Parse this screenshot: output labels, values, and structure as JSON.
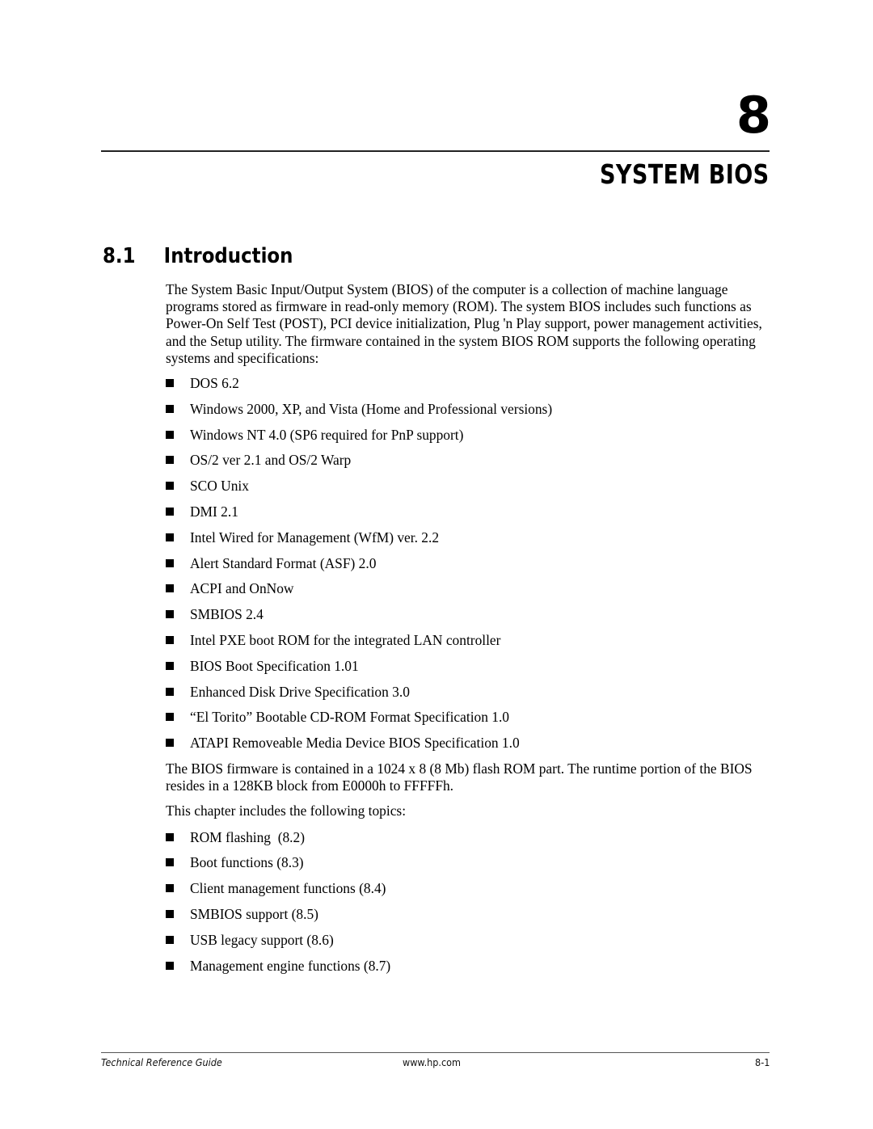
{
  "chapter": {
    "number": "8",
    "title": "SYSTEM BIOS"
  },
  "section": {
    "number": "8.1",
    "title": "Introduction"
  },
  "intro_paragraph": "The System Basic Input/Output System (BIOS) of the computer is a collection of machine language programs stored as firmware in read-only memory (ROM). The system BIOS includes such functions as Power-On Self Test (POST), PCI device initialization, Plug 'n Play support, power management activities, and the Setup utility. The firmware contained in the system BIOS ROM supports the following operating systems and specifications:",
  "supported_list": [
    "DOS 6.2",
    "Windows 2000, XP, and Vista (Home and Professional versions)",
    "Windows NT 4.0 (SP6 required for PnP support)",
    "OS/2 ver 2.1 and OS/2 Warp",
    "SCO Unix",
    "DMI 2.1",
    "Intel Wired for Management (WfM) ver. 2.2",
    "Alert Standard Format (ASF) 2.0",
    "ACPI and OnNow",
    "SMBIOS 2.4",
    "Intel PXE boot ROM for the integrated LAN controller",
    "BIOS Boot Specification 1.01",
    "Enhanced Disk Drive Specification 3.0",
    "“El Torito” Bootable CD-ROM Format Specification 1.0",
    "ATAPI Removeable Media Device BIOS Specification 1.0"
  ],
  "firmware_paragraph": "The BIOS firmware is contained in a 1024 x 8 (8 Mb) flash ROM part. The runtime portion of the BIOS resides in a 128KB block from E0000h to FFFFFh.",
  "topics_intro": "This chapter includes the following topics:",
  "topics_list": [
    "ROM flashing  (8.2)",
    "Boot functions (8.3)",
    "Client management functions (8.4)",
    "SMBIOS support (8.5)",
    "USB legacy support (8.6)",
    "Management engine functions (8.7)"
  ],
  "footer": {
    "left": "Technical Reference Guide",
    "center": "www.hp.com",
    "right": "8-1"
  }
}
